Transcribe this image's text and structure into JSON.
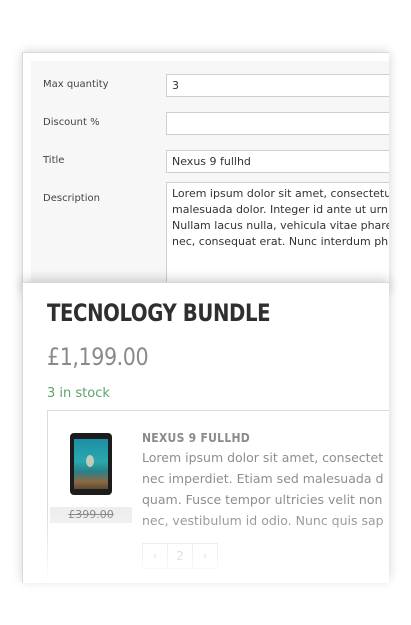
{
  "settings": {
    "fields": [
      {
        "label": "Max quantity",
        "value": "3"
      },
      {
        "label": "Discount %",
        "value": ""
      },
      {
        "label": "Title",
        "value": "Nexus 9 fullhd"
      }
    ],
    "description": {
      "label": "Description",
      "lines": [
        "Lorem ipsum dolor sit amet, consectetu",
        "malesuada dolor. Integer id ante ut urn",
        "Nullam lacus nulla, vehicula vitae phare",
        "nec, consequat erat. Nunc interdum ph"
      ]
    }
  },
  "product": {
    "title": "TECNOLOGY BUNDLE",
    "price": "£1,199.00",
    "stock": "3 in stock",
    "bundle_item": {
      "image": "tablet-icon",
      "old_price": "£399.00",
      "title": "NEXUS 9 FULLHD",
      "desc_lines": [
        "Lorem ipsum dolor sit amet, consectet",
        "nec imperdiet. Etiam sed malesuada d",
        "quam. Fusce tempor ultricies velit non",
        "nec, vestibulum id odio. Nunc quis sap"
      ],
      "stepper": {
        "decrement": "‹",
        "value": "2",
        "increment": "›"
      }
    }
  },
  "colors": {
    "stock": "#5aa469",
    "price": "#8a8a8a",
    "title": "#2f2f2f"
  }
}
